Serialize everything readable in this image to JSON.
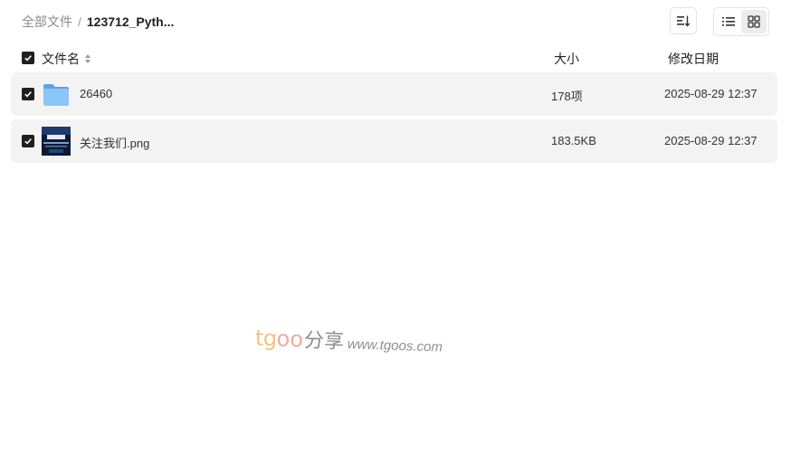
{
  "breadcrumb": {
    "root": "全部文件",
    "separator": "/",
    "current": "123712_Pyth..."
  },
  "toolbar": {
    "sort_icon": "sort-icon",
    "view_list_icon": "list-view-icon",
    "view_grid_icon": "grid-view-icon",
    "active_view": "list"
  },
  "table": {
    "columns": {
      "name": "文件名",
      "size": "大小",
      "date": "修改日期"
    },
    "rows": [
      {
        "name": "26460",
        "size": "178项",
        "date": "2025-08-29 12:37",
        "type": "folder",
        "checked": true
      },
      {
        "name": "关注我们.png",
        "size": "183.5KB",
        "date": "2025-08-29 12:37",
        "type": "image",
        "checked": true
      }
    ]
  },
  "watermark": {
    "tg": "tg",
    "oo": "oo",
    "cn": "分享",
    "url": "www.tgoos.com"
  },
  "colors": {
    "checkbox": "#1f1f1f",
    "row_bg": "#f3f3f3",
    "folder": "#6fb3f0",
    "watermark_orange": "#f2c27c",
    "watermark_pink": "#f1a9a9"
  }
}
